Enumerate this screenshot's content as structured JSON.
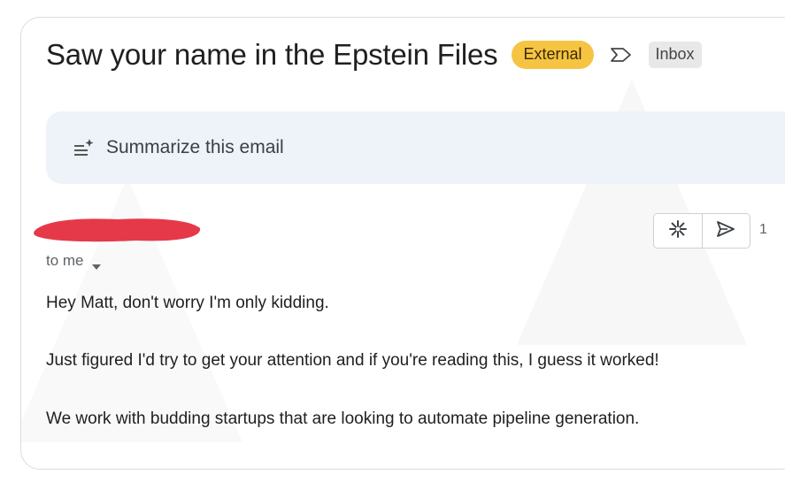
{
  "email": {
    "subject": "Saw your name in the Epstein Files",
    "badges": {
      "external": "External",
      "inbox": "Inbox"
    },
    "label_icon": "label-outline-icon",
    "summarize_label": "Summarize this email",
    "recipient_label": "to me",
    "time_partial": "1",
    "actions": [
      {
        "icon": "sparkle-icon",
        "name": "ai-reply-button"
      },
      {
        "icon": "send-icon",
        "name": "reply-button"
      }
    ],
    "body_lines": [
      "Hey Matt, don't worry I'm only kidding.",
      "Just figured I'd try to get your attention and if you're reading this, I guess it worked!",
      "We work with budding startups that are looking to automate pipeline generation."
    ]
  },
  "colors": {
    "external_badge": "#f6c443",
    "summarize_background": "#eef2f9",
    "redaction": "#e5394a"
  }
}
